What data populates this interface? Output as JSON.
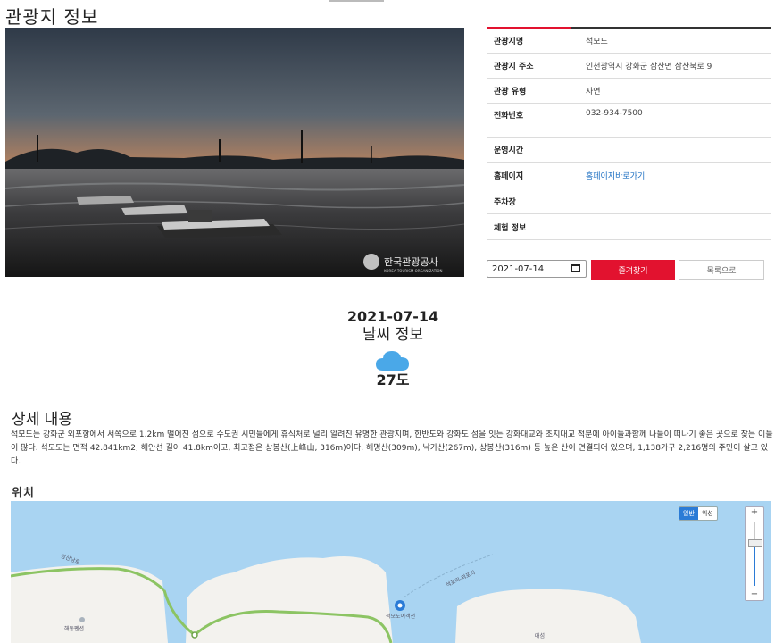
{
  "page": {
    "title": "관광지 정보"
  },
  "photo": {
    "watermark": "한국관광공사",
    "watermark_sub": "KOREA TOURISM ORGANIZATION"
  },
  "info": {
    "rows": [
      {
        "key": "관광지명",
        "value": "석모도"
      },
      {
        "key": "관광지 주소",
        "value": "인천광역시 강화군 삼산면 삼산북로 9"
      },
      {
        "key": "관광 유형",
        "value": "자연"
      },
      {
        "key": "전화번호",
        "value": "032-934-7500"
      },
      {
        "key": "운영시간",
        "value": ""
      },
      {
        "key": "홈페이지",
        "value": "홈페이지바로가기",
        "link": true
      },
      {
        "key": "주차장",
        "value": ""
      },
      {
        "key": "체험 정보",
        "value": ""
      }
    ]
  },
  "actions": {
    "date_value": "2021-07-14",
    "favorite_label": "즐겨찾기",
    "list_label": "목록으로"
  },
  "weather": {
    "date": "2021-07-14",
    "title": "날씨 정보",
    "icon": "cloud-icon",
    "temperature": "27도"
  },
  "detail": {
    "title": "상세 내용",
    "body": "석모도는 강화군 외포항에서 서쪽으로 1.2km 떨어진 섬으로 수도권 시민들에게 휴식처로 널리 알려진 유명한 관광지며, 한반도와 강화도 섬을 잇는 강화대교와 초지대교 적분에 아이들과함께 나들이 떠나기 좋은 곳으로 찾는 이들이 많다. 석모도는 면적 42.841km2, 해안선 길이 41.8km이고, 최고점은 상봉산(上峰山, 316m)이다. 해명산(309m), 낙가산(267m), 상봉산(316m) 등 높은 산이 연결되어 있으며, 1,138가구 2,216명의 주민이 살고 있다."
  },
  "location": {
    "title": "위치",
    "map_mode_normal": "일반",
    "map_mode_satellite": "위성",
    "zoom_in": "+",
    "zoom_out": "−",
    "labels": {
      "road": "삼산남로",
      "place1": "해동펜션",
      "place2": "석모도여객선",
      "place3": "대섬",
      "route": "석포리-외포리"
    }
  },
  "colors": {
    "accent": "#e2122f",
    "link": "#1b6ec2",
    "sea": "#a9d4f2",
    "land": "#f3f2ee"
  }
}
